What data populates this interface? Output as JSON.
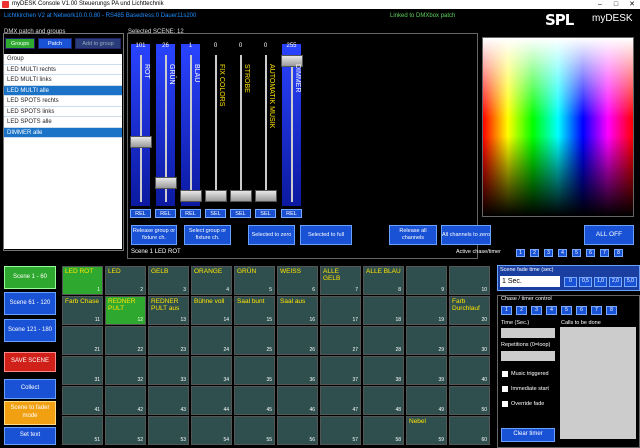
{
  "window": {
    "title": "myDESK Console V1.00  Steuerungs PA und Lichttechnik"
  },
  "header": {
    "info": "Lichtkirchen V2 at Network10.0.0.80 - RS485 Basedress:0 Dauer11s200",
    "linked": "Linked to DMXbox patch",
    "logo": "SPL",
    "app": "myDESK"
  },
  "groups": {
    "title": "DMX patch and groups",
    "btn_groups": "Groups",
    "btn_patch": "Patch",
    "btn_add": "Add to group",
    "items": [
      {
        "label": "Group",
        "sel": false
      },
      {
        "label": "LED MULTI rechts",
        "sel": false
      },
      {
        "label": "LED MULTI links",
        "sel": false
      },
      {
        "label": "LED MULTI alle",
        "sel": true
      },
      {
        "label": "LED SPOTS rechts",
        "sel": false
      },
      {
        "label": "LED SPOTS links",
        "sel": false
      },
      {
        "label": "LED SPOTS alle",
        "sel": false
      },
      {
        "label": "DIMMER alle",
        "sel": true
      }
    ]
  },
  "scene": {
    "title": "Selected SCENE: 12",
    "faders": [
      {
        "label": "ROT",
        "value": "101",
        "level": 0.4,
        "btn": "REL",
        "blue": true
      },
      {
        "label": "GRÜN",
        "value": "26",
        "level": 0.1,
        "btn": "REL",
        "blue": true
      },
      {
        "label": "BLAU",
        "value": "1",
        "level": 0.0,
        "btn": "REL",
        "blue": true
      },
      {
        "label": "FIX COLORS",
        "value": "0",
        "level": 0.0,
        "btn": "SEL",
        "blue": false
      },
      {
        "label": "STROBE",
        "value": "0",
        "level": 0.0,
        "btn": "SEL",
        "blue": false
      },
      {
        "label": "AUTOMATIK MUSIK",
        "value": "0",
        "level": 0.0,
        "btn": "SEL",
        "blue": false
      },
      {
        "label": "DIMMER",
        "value": "255",
        "level": 1.0,
        "btn": "REL",
        "blue": true
      }
    ],
    "btn_release_group": "Release group or fixture ch.",
    "btn_select_group": "Select group or fixture ch.",
    "btn_sel_zero": "Selected to zero",
    "btn_sel_full": "Selected to full",
    "btn_release_all": "Release all channels",
    "btn_all_zero": "All channels to zero",
    "btn_all_off": "ALL OFF",
    "scene_label": "Scene 1  LED ROT",
    "chase_label": "Active chase/timer"
  },
  "sidebar": {
    "scene1": "Scene 1 - 60",
    "scene2": "Scene 61 - 120",
    "scene3": "Scene 121 - 180",
    "save": "SAVE SCENE",
    "collect": "Collect",
    "fader": "Scene to fader mode",
    "settext": "Set text"
  },
  "cells": [
    {
      "n": "1",
      "t": "LED ROT",
      "g": true
    },
    {
      "n": "2",
      "t": "LED",
      "g": false
    },
    {
      "n": "3",
      "t": "GELB",
      "g": false
    },
    {
      "n": "4",
      "t": "ORANGE",
      "g": false
    },
    {
      "n": "5",
      "t": "GRÜN",
      "g": false
    },
    {
      "n": "6",
      "t": "WEISS",
      "g": false
    },
    {
      "n": "7",
      "t": "ALLE GELB",
      "g": false
    },
    {
      "n": "8",
      "t": "ALLE BLAU",
      "g": false
    },
    {
      "n": "9",
      "t": "",
      "g": false
    },
    {
      "n": "10",
      "t": "",
      "g": false
    },
    {
      "n": "11",
      "t": "Farb Chase",
      "g": false
    },
    {
      "n": "12",
      "t": "REDNER PULT",
      "g": true
    },
    {
      "n": "13",
      "t": "REDNER PULT aus",
      "g": false
    },
    {
      "n": "14",
      "t": "Bühne voll",
      "g": false
    },
    {
      "n": "15",
      "t": "Saal bunt",
      "g": false
    },
    {
      "n": "16",
      "t": "Saal aus",
      "g": false
    },
    {
      "n": "17",
      "t": "",
      "g": false
    },
    {
      "n": "18",
      "t": "",
      "g": false
    },
    {
      "n": "19",
      "t": "",
      "g": false
    },
    {
      "n": "20",
      "t": "Farb Durchlauf",
      "g": false
    },
    {
      "n": "21",
      "t": "",
      "g": false
    },
    {
      "n": "22",
      "t": "",
      "g": false
    },
    {
      "n": "23",
      "t": "",
      "g": false
    },
    {
      "n": "24",
      "t": "",
      "g": false
    },
    {
      "n": "25",
      "t": "",
      "g": false
    },
    {
      "n": "26",
      "t": "",
      "g": false
    },
    {
      "n": "27",
      "t": "",
      "g": false
    },
    {
      "n": "28",
      "t": "",
      "g": false
    },
    {
      "n": "29",
      "t": "",
      "g": false
    },
    {
      "n": "30",
      "t": "",
      "g": false
    },
    {
      "n": "31",
      "t": "",
      "g": false
    },
    {
      "n": "32",
      "t": "",
      "g": false
    },
    {
      "n": "33",
      "t": "",
      "g": false
    },
    {
      "n": "34",
      "t": "",
      "g": false
    },
    {
      "n": "35",
      "t": "",
      "g": false
    },
    {
      "n": "36",
      "t": "",
      "g": false
    },
    {
      "n": "37",
      "t": "",
      "g": false
    },
    {
      "n": "38",
      "t": "",
      "g": false
    },
    {
      "n": "39",
      "t": "",
      "g": false
    },
    {
      "n": "40",
      "t": "",
      "g": false
    },
    {
      "n": "41",
      "t": "",
      "g": false
    },
    {
      "n": "42",
      "t": "",
      "g": false
    },
    {
      "n": "43",
      "t": "",
      "g": false
    },
    {
      "n": "44",
      "t": "",
      "g": false
    },
    {
      "n": "45",
      "t": "",
      "g": false
    },
    {
      "n": "46",
      "t": "",
      "g": false
    },
    {
      "n": "47",
      "t": "",
      "g": false
    },
    {
      "n": "48",
      "t": "",
      "g": false
    },
    {
      "n": "49",
      "t": "",
      "g": false
    },
    {
      "n": "50",
      "t": "",
      "g": false
    },
    {
      "n": "51",
      "t": "",
      "g": false
    },
    {
      "n": "52",
      "t": "",
      "g": false
    },
    {
      "n": "53",
      "t": "",
      "g": false
    },
    {
      "n": "54",
      "t": "",
      "g": false
    },
    {
      "n": "55",
      "t": "",
      "g": false
    },
    {
      "n": "56",
      "t": "",
      "g": false
    },
    {
      "n": "57",
      "t": "",
      "g": false
    },
    {
      "n": "58",
      "t": "",
      "g": false
    },
    {
      "n": "59",
      "t": "Nebel",
      "g": false
    },
    {
      "n": "60",
      "t": "",
      "g": false
    }
  ],
  "right": {
    "fade_title": "Scene fade time (sec)",
    "fade_value": "1 Sec.",
    "fade_btns": [
      "0",
      "0,5",
      "1,0",
      "2,0",
      "5,0"
    ],
    "chase_title": "Chase / timer control",
    "chase_btns": [
      "1",
      "2",
      "3",
      "4",
      "5",
      "6",
      "7",
      "8"
    ],
    "time_label": "Time (Sec.)",
    "calls_label": "Calls to be done",
    "rep_label": "Repetitions (0=loop)",
    "music": "Music triggered",
    "immediate": "Immediate start",
    "override": "Override fade",
    "clear": "Clear timer"
  },
  "chase_top": [
    "1",
    "2",
    "3",
    "4",
    "5",
    "6",
    "7",
    "8"
  ]
}
